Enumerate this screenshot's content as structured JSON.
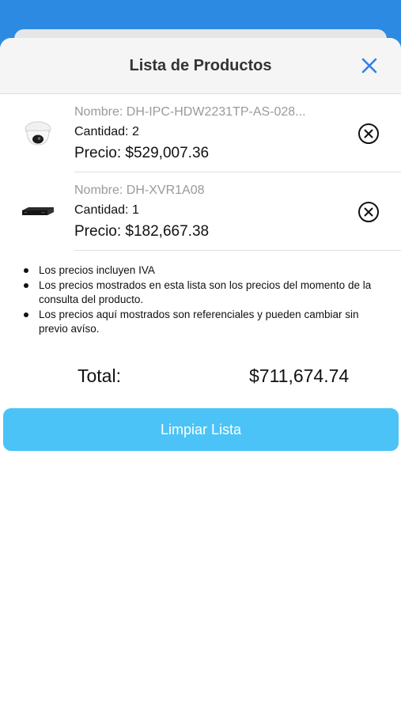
{
  "colors": {
    "top_background": "#2d8ae3",
    "accent_close": "#2f80ed",
    "clear_button": "#4cc3f6"
  },
  "header": {
    "title": "Lista de Productos",
    "close_icon": "close-icon"
  },
  "products": [
    {
      "name": "Nombre: DH-IPC-HDW2231TP-AS-028...",
      "quantity": "Cantidad: 2",
      "price": "Precio: $529,007.36",
      "image": "dome-camera-image",
      "remove_icon": "remove-circle-icon"
    },
    {
      "name": "Nombre: DH-XVR1A08",
      "quantity": "Cantidad: 1",
      "price": "Precio: $182,667.38",
      "image": "video-recorder-image",
      "remove_icon": "remove-circle-icon"
    }
  ],
  "notes": [
    "Los precios incluyen IVA",
    "Los precios mostrados en esta lista son los precios del momento de la consulta del producto.",
    "Los precios aquí mostrados son referenciales y pueden cambiar sin previo avíso."
  ],
  "total": {
    "label": "Total:",
    "value": "$711,674.74"
  },
  "actions": {
    "clear_label": "Limpiar Lista"
  }
}
